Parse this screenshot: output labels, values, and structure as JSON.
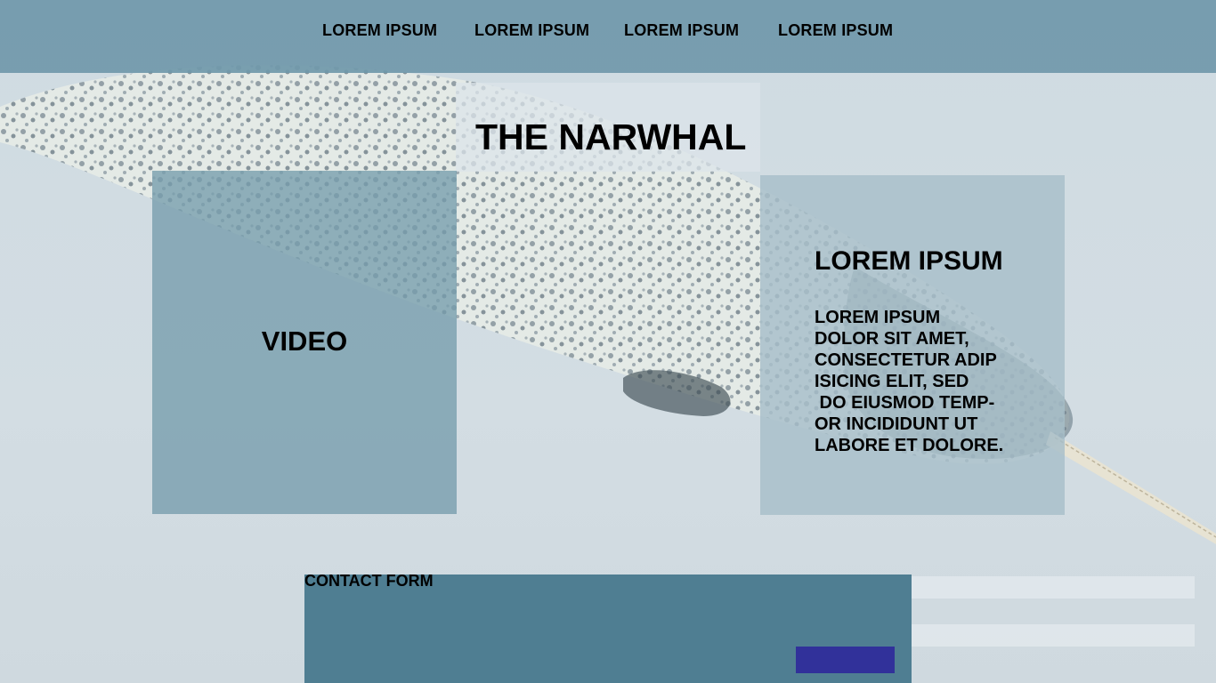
{
  "nav": {
    "items": [
      {
        "label": "LOREM IPSUM"
      },
      {
        "label": "LOREM IPSUM"
      },
      {
        "label": "LOREM IPSUM"
      },
      {
        "label": "LOREM IPSUM"
      }
    ]
  },
  "title": "THE NARWHAL",
  "video": {
    "label": "VIDEO"
  },
  "info": {
    "heading": "LOREM IPSUM",
    "body": "LOREM IPSUM\nDOLOR SIT AMET,\nCONSECTETUR ADIP\nISICING ELIT, SED\n DO EIUSMOD TEMP-\nOR INCIDIDUNT UT\nLABORE ET DOLORE."
  },
  "contact": {
    "label": "CONTACT FORM"
  },
  "colors": {
    "navbar": "#7098aa",
    "contact_panel": "#4f7e92",
    "submit_button": "#31319a",
    "video_panel": "#769cac",
    "info_panel": "#a7bec9"
  }
}
